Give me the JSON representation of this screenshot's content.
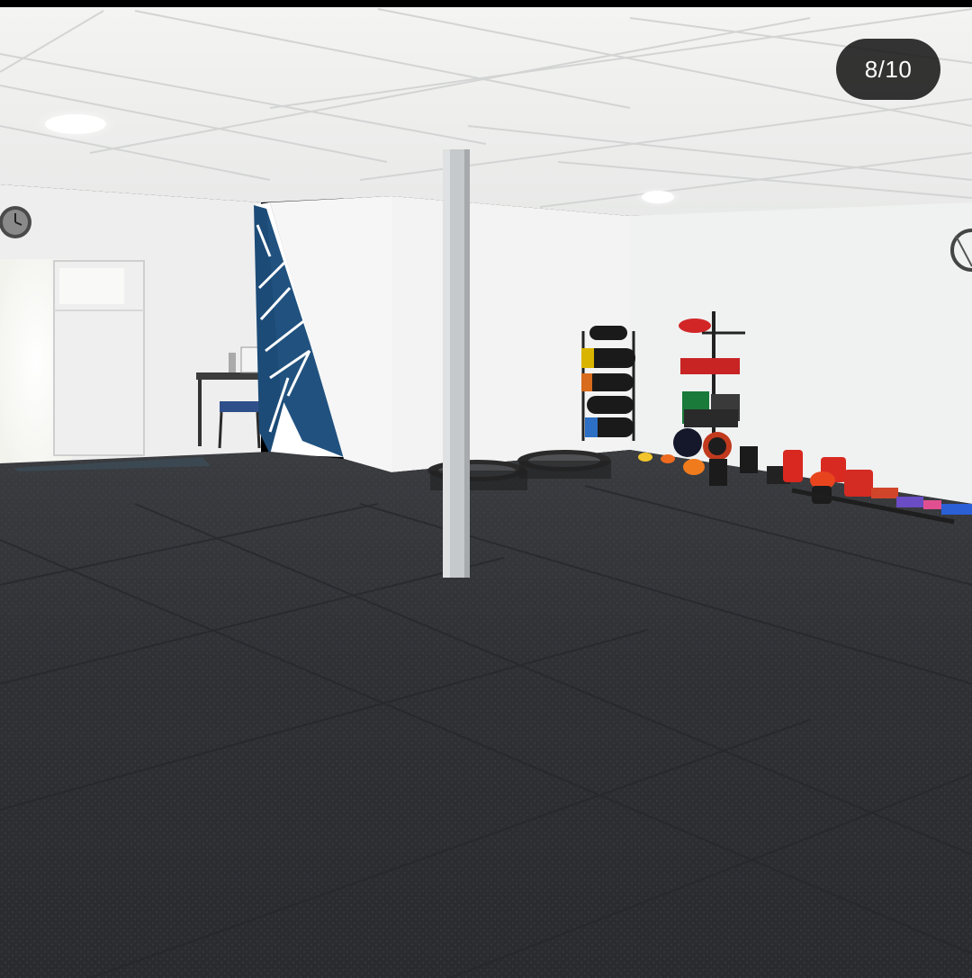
{
  "viewer": {
    "counter": "8/10",
    "background_color": "#000000"
  },
  "photo": {
    "subject": "gym-interior-photo",
    "colors": {
      "ceiling": "#eeeeec",
      "walls": "#f2f3f3",
      "floor_mat": "#2f3033",
      "accent_wall_blue": "#1f4f7a",
      "pillar": "#c4c7c9"
    }
  }
}
